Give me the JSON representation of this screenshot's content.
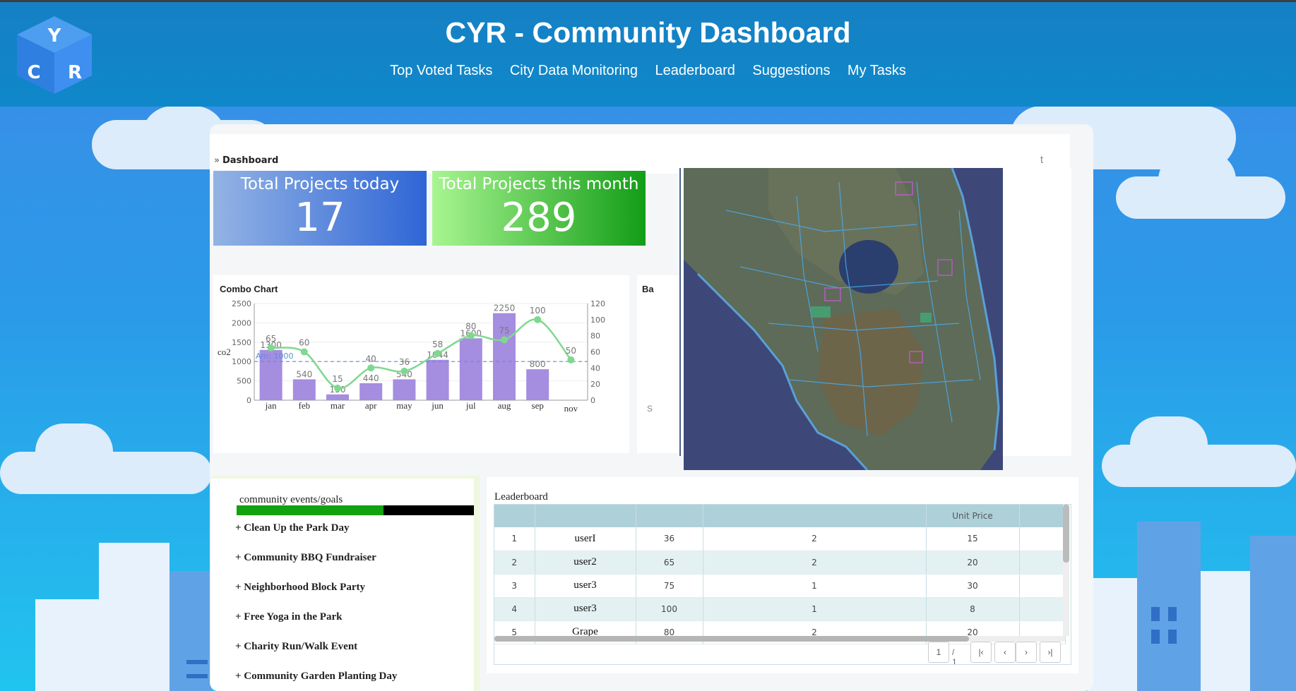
{
  "header": {
    "title": "CYR - Community Dashboard",
    "logo_letters": [
      "Y",
      "C",
      "R"
    ],
    "nav": [
      "Top Voted Tasks",
      "City Data Monitoring",
      "Leaderboard",
      "Suggestions",
      "My Tasks"
    ]
  },
  "breadcrumb": {
    "label": "Dashboard",
    "trailing": "t"
  },
  "kpis": [
    {
      "label": "Total Projects today",
      "value": "17"
    },
    {
      "label": "Total Projects this month",
      "value": "289"
    }
  ],
  "combo_card": {
    "title": "Combo Chart"
  },
  "side_card": {
    "title": "Ba",
    "letter": "S"
  },
  "chart_data": {
    "type": "bar",
    "title": "Combo Chart",
    "ylabel": "co2",
    "categories": [
      "jan",
      "feb",
      "mar",
      "apr",
      "may",
      "jun",
      "jul",
      "aug",
      "sep",
      "nov"
    ],
    "series": [
      {
        "type": "bar",
        "values": [
          1300,
          540,
          150,
          440,
          540,
          1044,
          1600,
          2250,
          800,
          null
        ],
        "axis": "left"
      },
      {
        "type": "line",
        "values": [
          65,
          60,
          15,
          40,
          36,
          58,
          80,
          75,
          100,
          50
        ],
        "axis": "right"
      }
    ],
    "ylim": [
      0,
      2500
    ],
    "yticks": [
      0,
      500,
      1000,
      1500,
      2000,
      2500
    ],
    "y2lim": [
      0,
      120
    ],
    "y2ticks": [
      0,
      20,
      40,
      60,
      80,
      100,
      120
    ],
    "markline": {
      "value": 1000,
      "label": "Am:  1000"
    },
    "bar_color": "#a58de0",
    "line_color": "#7fd88f"
  },
  "events": {
    "title": "community events/goals",
    "progress": 0.62,
    "items": [
      "+ Clean Up the Park Day",
      "+ Community BBQ Fundraiser",
      "+ Neighborhood Block Party",
      "+ Free Yoga in the Park",
      "+ Charity Run/Walk Event",
      "+ Community Garden Planting Day"
    ]
  },
  "leaderboard": {
    "title": "Leaderboard",
    "columns": [
      "",
      "",
      "",
      "",
      "Unit Price",
      ""
    ],
    "rows": [
      [
        "1",
        "userI",
        "36",
        "2",
        "15",
        ""
      ],
      [
        "2",
        "user2",
        "65",
        "2",
        "20",
        ""
      ],
      [
        "3",
        "user3",
        "75",
        "1",
        "30",
        ""
      ],
      [
        "4",
        "user3",
        "100",
        "1",
        "8",
        ""
      ],
      [
        "5",
        "Grape",
        "80",
        "2",
        "20",
        ""
      ]
    ],
    "pager": {
      "page": "1",
      "total": "/ 1"
    }
  },
  "colors": {
    "header": "#1580c4",
    "kpi_blue": "#2f66d6",
    "kpi_green": "#139d17",
    "table_header": "#aed0d9"
  }
}
